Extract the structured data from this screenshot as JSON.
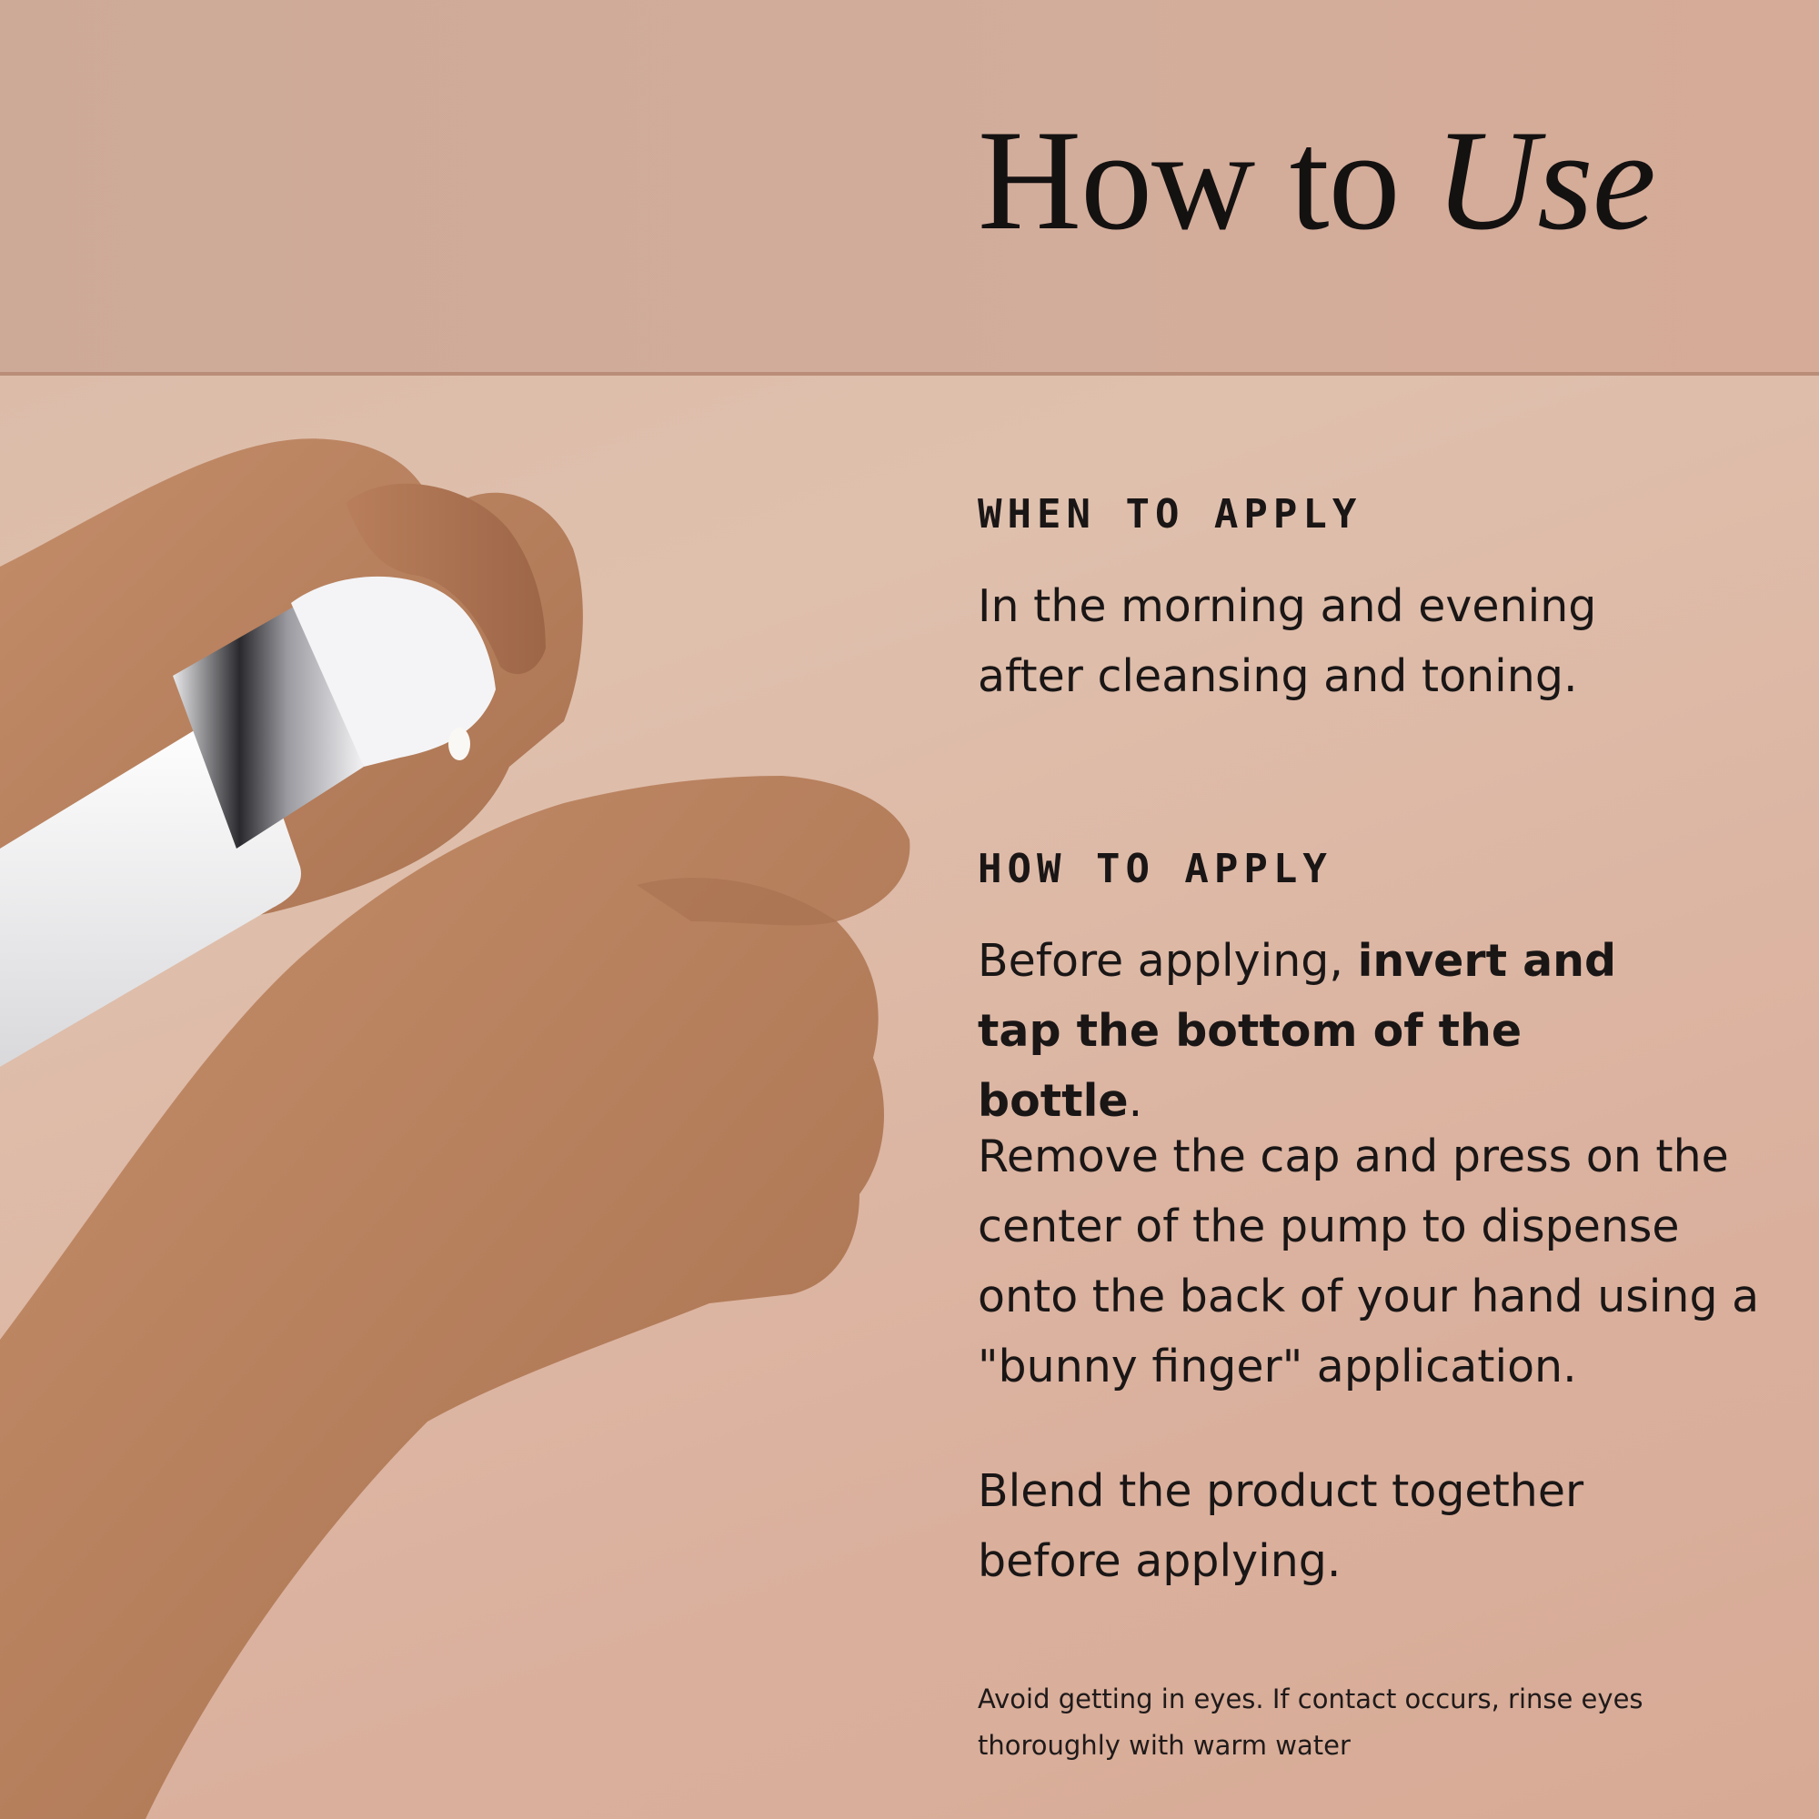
{
  "header": {
    "title_regular": "How to ",
    "title_italic": "Use"
  },
  "when_section": {
    "label": "WHEN TO APPLY",
    "text": "In the morning and evening after cleansing and toning."
  },
  "how_section": {
    "label": "HOW TO APPLY",
    "step1_regular": "Before applying, ",
    "step1_bold": "invert and tap the bottom of the bottle",
    "step1_end": ".",
    "step2": "Remove the cap and press on the center of the pump to dispense onto the back of your hand using a \"bunny finger\" application.",
    "step3": "Blend the product together before applying."
  },
  "footnote": "Avoid getting in eyes. If contact occurs, rinse eyes thoroughly with warm water",
  "colors": {
    "background": "#dbb9a6",
    "header_band": "#d1ab99",
    "divider": "#b98d78",
    "text": "#1a1616"
  }
}
